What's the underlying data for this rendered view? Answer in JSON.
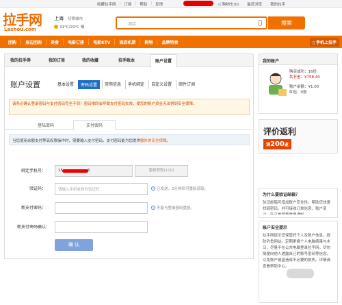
{
  "topbar": {
    "links": [
      "收藏拉手网",
      "订阅",
      "帮助",
      "反馈"
    ],
    "cart": "购物车(0)",
    "recent": "最近浏览",
    "my_lashou": "我的拉手"
  },
  "header": {
    "logo_cn": "拉手网",
    "logo_en": "Lashou.com",
    "city": "上海",
    "city_switch": "切换城市",
    "weather": "31°C/29°C 晴",
    "search_placeholder": "酒店",
    "search_button": "搜索"
  },
  "nav": {
    "items": [
      "团购",
      "身边团购",
      "美食",
      "电影订座",
      "电影KTV",
      "酒店机票",
      "购物",
      "品牌特卖"
    ],
    "mobile": "手机上拉手"
  },
  "tabs": [
    "我的拉手券",
    "我的订单",
    "我的收藏",
    "拉手账本",
    "账户设置"
  ],
  "account": {
    "title": "账户设置",
    "subtabs": [
      "基本设置",
      "密码设置",
      "常用信息",
      "手机绑定",
      "自定义设置",
      "邮件订阅"
    ],
    "warning": "请务必确认登录密码与支付密码完全不同！密码相同会导致支付密码失效，使您的账户资金无法得到安全保障。",
    "pw_tabs": [
      "登陆密码",
      "支付密码"
    ],
    "notice_main": "当您使用余额支付等高权限操作时，需要输入支付密码。支付密码能为您提供",
    "notice_emph": "额外的安全保障",
    "notice_end": "。",
    "fields": {
      "phone_label": "绑定手机号：",
      "phone_value": "15",
      "phone_tail": "6",
      "resend": "重新获取(110)",
      "code_label": "验证码：",
      "code_placeholder": "请输入手机收到的验证码",
      "code_hint": "已发送，2分钟后可重新获取。",
      "newpw_label": "新支付密码：",
      "newpw_hint": "不能与登录密码重复。",
      "confirm_label": "新支付密码确认：",
      "confirm_button": "确 认"
    }
  },
  "sidebar": {
    "account_title": "我的账户",
    "buy_count": "购买成功：16份",
    "saved": "共节省：¥758.40",
    "balance": "账户余额：¥1.00",
    "points": "红包：0张",
    "promo_big": "评价返利",
    "promo_sub_pre": "满",
    "promo_sub_num": "200",
    "promo_sub_post": "返",
    "why_title": "为什么要验证邮箱？",
    "why_body": "验证邮箱可增加账户安全性，帮助您快速找回密码，并可接收订单信息、账户变动、新品推荐等重要通知。",
    "safety_title": "账户安全提示",
    "safety_body": "拉手网提示您保管好个人及账户信息，提防钓鱼网站。定期更换个人电脑病毒与木马，尽量不在公共电脑登录拉手网。切勿随便向他人透露自己的账号密码等信息，以免账户被盗造成不必要的损失。详情请查看帮助中心。"
  }
}
